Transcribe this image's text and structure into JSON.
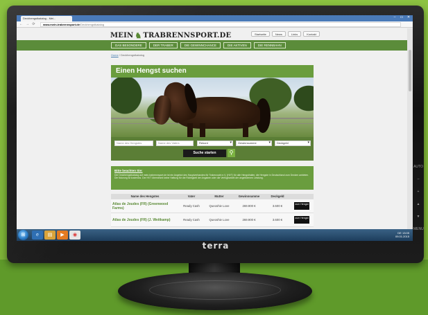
{
  "monitor": {
    "brand": "terra",
    "side_buttons": [
      "AUTO",
      "–",
      "+",
      "▲",
      "▼",
      "MENU",
      "⏻"
    ]
  },
  "browser": {
    "tab_label": "Deckhengstkatalog - Mei...",
    "tab_close": "×",
    "url_domain": "www.mein-trabrennsport.de",
    "url_path": "/Deckhengstkatalog",
    "window_controls": [
      "–",
      "▭",
      "✕"
    ],
    "nav_icons": [
      "←",
      "→",
      "⟳"
    ]
  },
  "site": {
    "logo_left": "MEIN",
    "logo_right": "TRABRENNSPORT.DE",
    "top_links": [
      "Startseite",
      "News",
      "Links",
      "Kontakt"
    ],
    "nav": [
      "DAS BESONDERE",
      "DER TRABER",
      "DIE GEWINNCHANCE",
      "DIE AKTIVEN",
      "DIE RENNBAHN"
    ],
    "breadcrumb_home": "Home",
    "breadcrumb_current": "Deckhengstkatalog"
  },
  "hero": {
    "title": "Einen Hengst suchen"
  },
  "search": {
    "stallion_placeholder": "Name des Hengstes",
    "sire_placeholder": "Name des Vaters",
    "record_label": "Rekord",
    "winnings_label": "Gewinnsumme",
    "stud_fee_label": "Deckgeld",
    "submit_label": "Suche starten"
  },
  "notice": {
    "title": "Bitte beachten Sie:",
    "text": "Der Deckhengstkatalog auf mein-trabrennsport.de ist ein Angebot des Hauptverbandes für Traberzucht e.V. (HVT) für alle Hengsthalter, die Hengste in Deutschland zum Decken anbieten. Die Nutzung ist kostenlos. Der HVT übernimmt keine Haftung für die Richtigkeit der Angaben oder die Verfügbarkeit der angebotenen Leistung."
  },
  "table": {
    "headers": [
      "Name des Hengstes",
      "Vater",
      "Mutter",
      "Gewinnsumme",
      "Deckgeld",
      ""
    ],
    "rows": [
      {
        "name": "Atlas de Joudes (FR) (Greenwood Farms)",
        "sire": "Ready Cash",
        "dam": "Queoshie Love",
        "winnings": "269.900 €",
        "fee": "3.600 €",
        "action": "zum Hengst"
      },
      {
        "name": "Atlas de Joudes (FR) (J. Weitkamp)",
        "sire": "Ready Cash",
        "dam": "Queoshie Love",
        "winnings": "269.900 €",
        "fee": "3.600 €",
        "action": "zum Hengst"
      }
    ]
  },
  "taskbar": {
    "start_glyph": "⊞",
    "app_icons": [
      "ie-icon",
      "folder-icon",
      "media-player-icon",
      "chrome-icon"
    ],
    "tray_lang": "DE",
    "time": "13:05",
    "date": "09.01.2015"
  },
  "colors": {
    "site_green": "#5b8c3a",
    "hero_green": "#6a9d3e",
    "background_green": "#7fb53a"
  }
}
